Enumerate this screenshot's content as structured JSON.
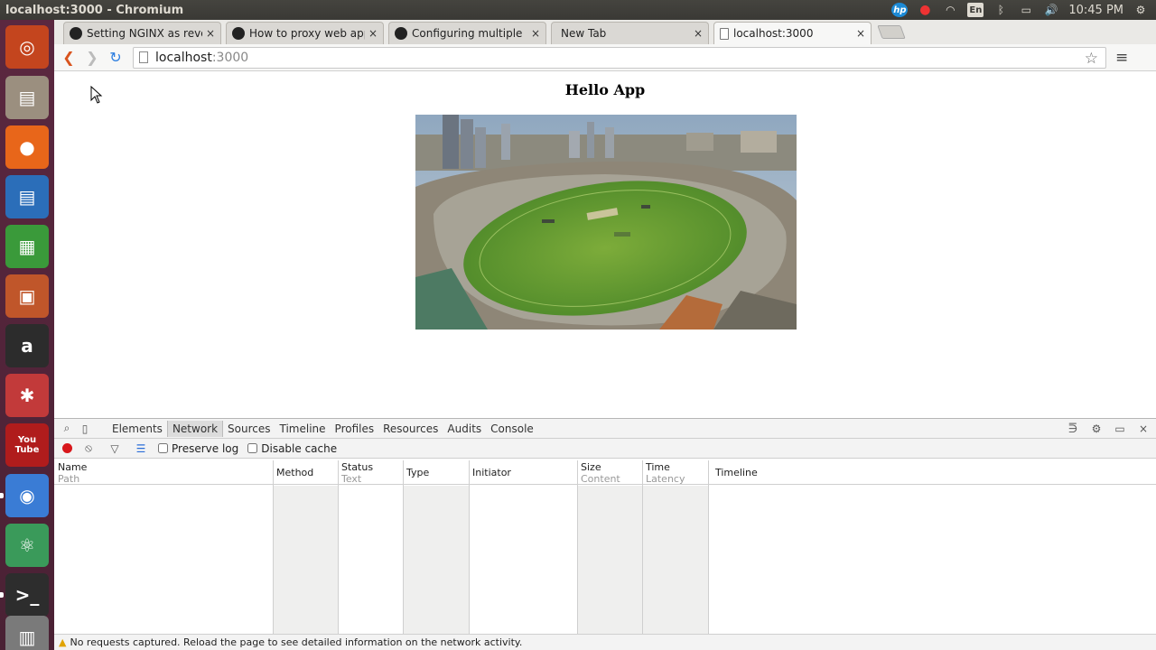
{
  "system": {
    "window_title": "localhost:3000 - Chromium",
    "indicators": [
      {
        "name": "hp-icon",
        "glyph": "hp"
      },
      {
        "name": "record-icon",
        "glyph": "●"
      },
      {
        "name": "wifi-icon",
        "glyph": "◠"
      },
      {
        "name": "keyboard-layout-indicator",
        "glyph": "En"
      },
      {
        "name": "bluetooth-icon",
        "glyph": "ᛒ"
      },
      {
        "name": "battery-icon",
        "glyph": "▭"
      },
      {
        "name": "volume-icon",
        "glyph": "🔊"
      }
    ],
    "clock": "10:45 PM",
    "settings_glyph": "⚙"
  },
  "launcher": {
    "items": [
      {
        "name": "ubuntu-dash-icon",
        "glyph": "◎",
        "bg": "#c4451e"
      },
      {
        "name": "files-icon",
        "glyph": "▤",
        "bg": "#9b8f7f"
      },
      {
        "name": "firefox-icon",
        "glyph": "●",
        "bg": "#e8661a"
      },
      {
        "name": "libreoffice-writer-icon",
        "glyph": "▤",
        "bg": "#2b6eb9"
      },
      {
        "name": "libreoffice-calc-icon",
        "glyph": "▦",
        "bg": "#3a9a3a"
      },
      {
        "name": "libreoffice-impress-icon",
        "glyph": "▣",
        "bg": "#c0562a"
      },
      {
        "name": "amazon-icon",
        "glyph": "a",
        "bg": "#2c2c2c"
      },
      {
        "name": "system-settings-icon",
        "glyph": "✱",
        "bg": "#c23a3a"
      },
      {
        "name": "youtube-icon",
        "glyph": "You Tube",
        "bg": "#b01c1c"
      },
      {
        "name": "chromium-icon",
        "glyph": "◉",
        "bg": "#3a7cd5"
      },
      {
        "name": "atom-icon",
        "glyph": "⚛",
        "bg": "#3a9a5a"
      },
      {
        "name": "terminal-icon",
        "glyph": ">_",
        "bg": "#2d2d2d"
      },
      {
        "name": "trash-icon",
        "glyph": "▥",
        "bg": "#7a7a7a"
      }
    ]
  },
  "browser": {
    "tabs": [
      {
        "title": "Setting NGINX as reve",
        "icon": "github"
      },
      {
        "title": "How to proxy web app",
        "icon": "github"
      },
      {
        "title": "Configuring multiple",
        "icon": "github"
      },
      {
        "title": "New Tab",
        "icon": "none"
      },
      {
        "title": "localhost:3000",
        "icon": "page"
      }
    ],
    "close_glyph": "×",
    "address": {
      "host": "localhost",
      "port": ":3000"
    }
  },
  "page": {
    "heading": "Hello App"
  },
  "devtools": {
    "panel_tabs": [
      "Elements",
      "Network",
      "Sources",
      "Timeline",
      "Profiles",
      "Resources",
      "Audits",
      "Console"
    ],
    "active_tab": "Network",
    "preserve_log_label": "Preserve log",
    "disable_cache_label": "Disable cache",
    "columns": [
      {
        "label": "Name",
        "sub": "Path"
      },
      {
        "label": "Method",
        "sub": ""
      },
      {
        "label": "Status",
        "sub": "Text"
      },
      {
        "label": "Type",
        "sub": ""
      },
      {
        "label": "Initiator",
        "sub": ""
      },
      {
        "label": "Size",
        "sub": "Content"
      },
      {
        "label": "Time",
        "sub": "Latency"
      },
      {
        "label": "Timeline",
        "sub": ""
      }
    ],
    "status_message": "No requests captured. Reload the page to see detailed information on the network activity."
  }
}
